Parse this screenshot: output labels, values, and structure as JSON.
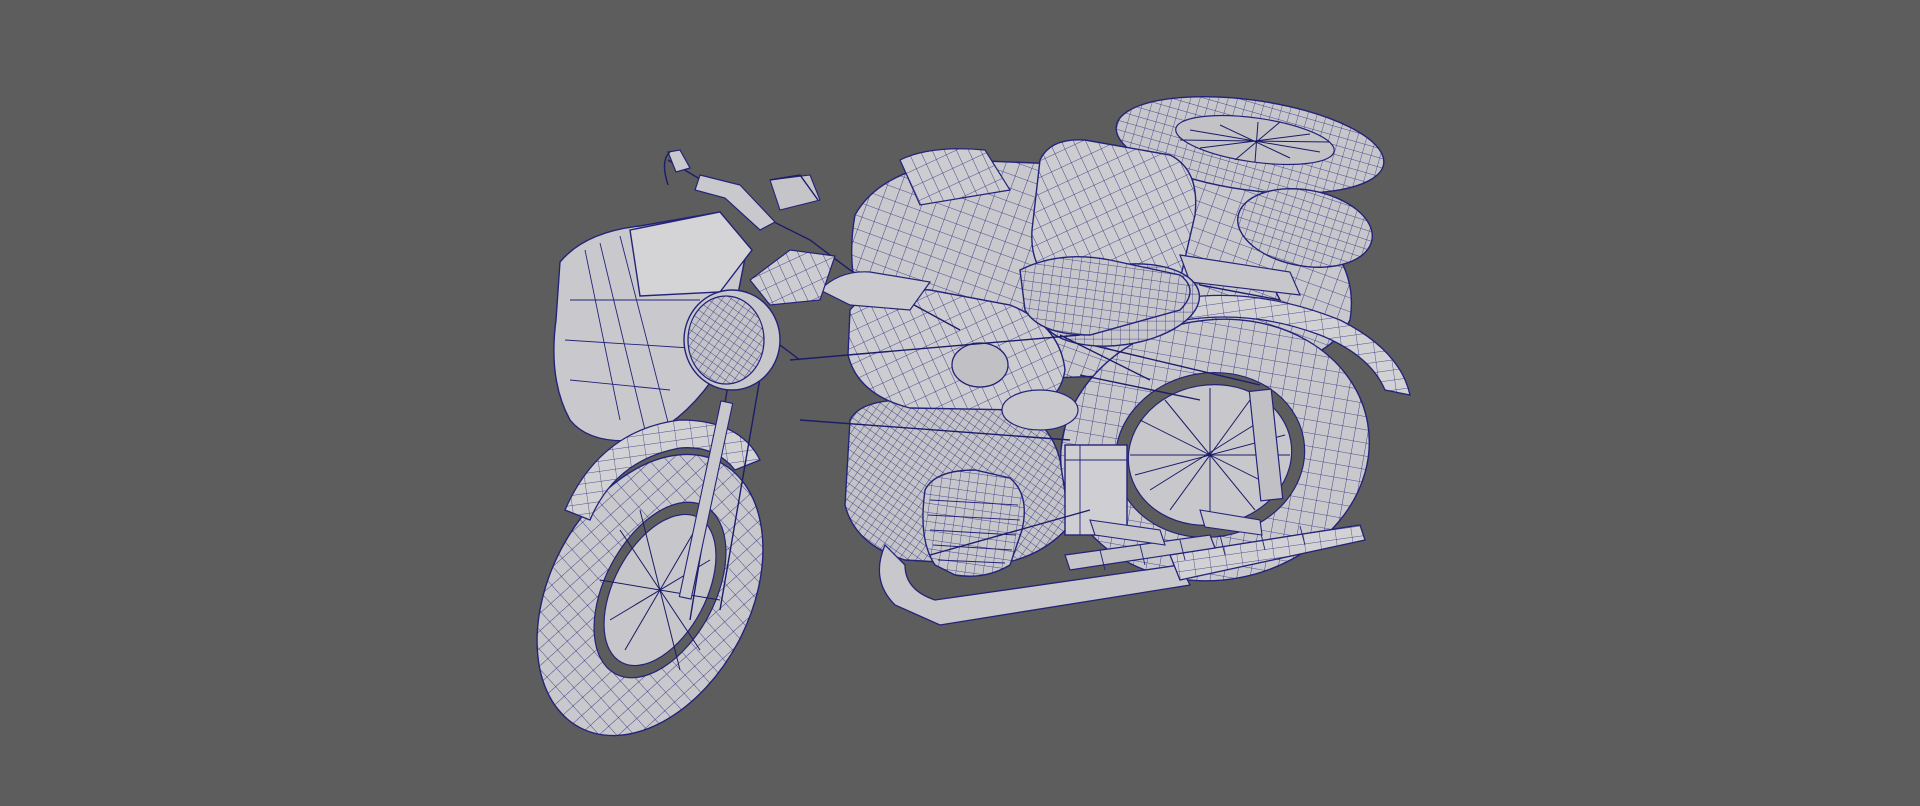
{
  "viewport": {
    "background_color": "#5d5d5d",
    "wire_color": "#23237a",
    "surface_color": "#c9c9cd"
  },
  "model": {
    "subject": "motorcycle-with-sidecar",
    "display_mode": "wireframe-on-shaded"
  }
}
